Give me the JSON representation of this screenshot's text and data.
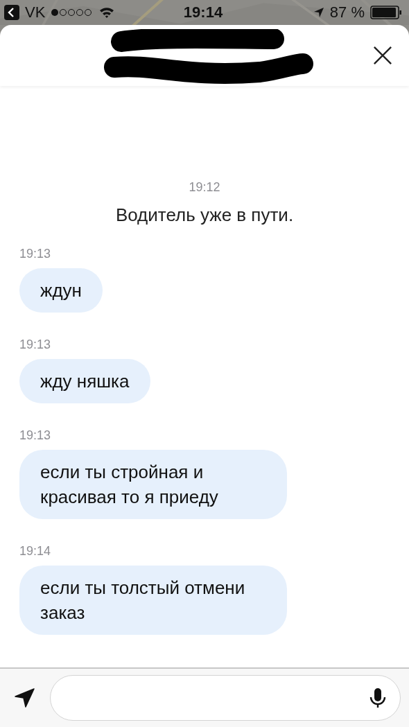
{
  "status_bar": {
    "back_app": "VK",
    "time": "19:14",
    "battery": "87 %"
  },
  "messages": [
    {
      "kind": "system",
      "time": "19:12",
      "text": "Водитель уже в пути."
    },
    {
      "kind": "incoming",
      "time": "19:13",
      "text": "ждун"
    },
    {
      "kind": "incoming",
      "time": "19:13",
      "text": "жду няшка"
    },
    {
      "kind": "incoming",
      "time": "19:13",
      "text": "если ты стройная и красивая то я приеду"
    },
    {
      "kind": "incoming",
      "time": "19:14",
      "text": "если ты толстый отмени заказ"
    }
  ]
}
